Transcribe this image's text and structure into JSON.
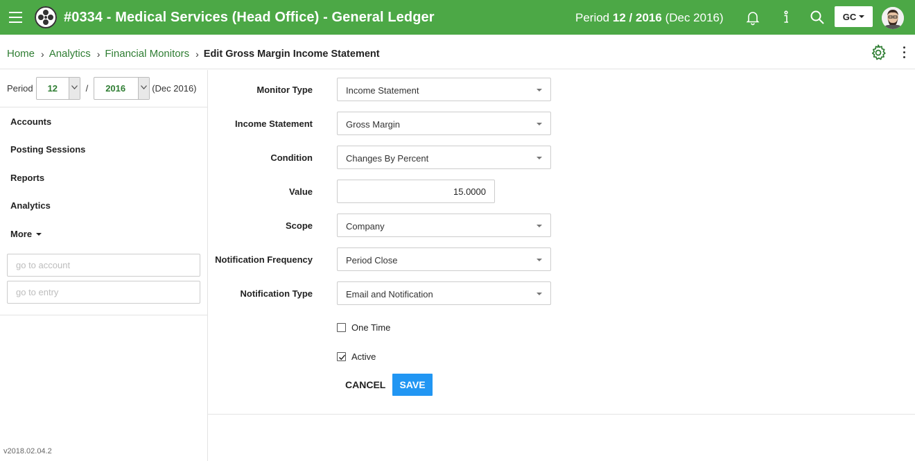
{
  "header": {
    "title": "#0334 - Medical Services (Head Office) - General Ledger",
    "period_prefix": "Period",
    "period_month": "12",
    "period_slash": "/",
    "period_year": "2016",
    "period_suffix": "(Dec 2016)",
    "user_initials": "GC",
    "icons": [
      "menu-icon",
      "app-logo",
      "bell-icon",
      "info-icon",
      "search-icon",
      "user-avatar"
    ],
    "brand_color": "#4ca846"
  },
  "breadcrumb": {
    "items": [
      "Home",
      "Analytics",
      "Financial Monitors"
    ],
    "current": "Edit Gross Margin Income Statement"
  },
  "sidebar": {
    "period_label": "Period",
    "month": "12",
    "slash": "/",
    "year": "2016",
    "period_text": "(Dec 2016)",
    "nav": [
      "Accounts",
      "Posting Sessions",
      "Reports",
      "Analytics",
      "More"
    ],
    "account_placeholder": "go to account",
    "entry_placeholder": "go to entry",
    "version": "v2018.02.04.2"
  },
  "form": {
    "monitor_type": {
      "label": "Monitor Type",
      "value": "Income Statement"
    },
    "income_statement": {
      "label": "Income Statement",
      "value": "Gross Margin"
    },
    "condition": {
      "label": "Condition",
      "value": "Changes By Percent"
    },
    "value": {
      "label": "Value",
      "value": "15.0000"
    },
    "scope": {
      "label": "Scope",
      "value": "Company"
    },
    "notification_frequency": {
      "label": "Notification Frequency",
      "value": "Period Close"
    },
    "notification_type": {
      "label": "Notification Type",
      "value": "Email and Notification"
    },
    "one_time": {
      "label": "One Time",
      "checked": false
    },
    "active": {
      "label": "Active",
      "checked": true
    },
    "cancel_label": "CANCEL",
    "save_label": "SAVE",
    "save_color": "#2196f3"
  }
}
